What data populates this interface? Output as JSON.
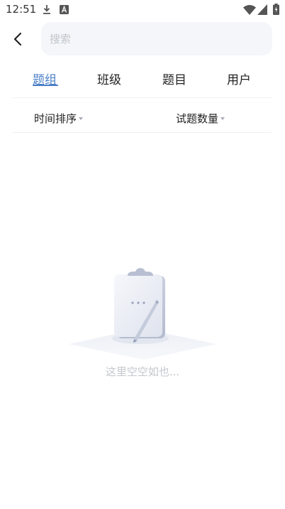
{
  "status_bar": {
    "time": "12:51",
    "icons": [
      "download-icon",
      "text-a-icon",
      "wifi-icon",
      "signal-icon",
      "battery-icon"
    ]
  },
  "search": {
    "placeholder": "搜索"
  },
  "tabs": [
    {
      "label": "题组",
      "active": true
    },
    {
      "label": "班级",
      "active": false
    },
    {
      "label": "题目",
      "active": false
    },
    {
      "label": "用户",
      "active": false
    }
  ],
  "sort": {
    "time_label": "时间排序",
    "count_label": "试题数量"
  },
  "empty": {
    "message": "这里空空如也..."
  },
  "colors": {
    "accent": "#4a7fc8",
    "search_bg": "#f4f6f9",
    "muted_text": "#c4c7cc"
  }
}
